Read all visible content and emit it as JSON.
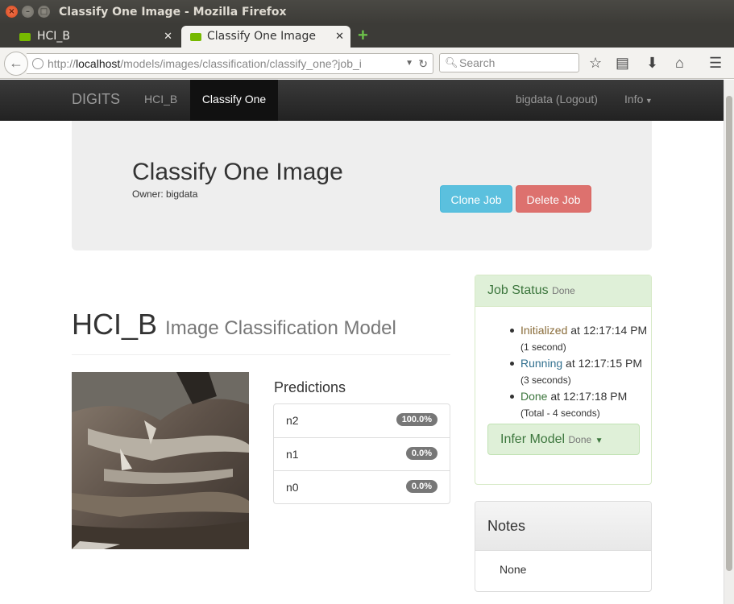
{
  "window": {
    "title": "Classify One Image - Mozilla Firefox"
  },
  "browser": {
    "tabs": [
      {
        "label": "HCI_B"
      },
      {
        "label": "Classify One Image"
      }
    ],
    "url_host": "localhost",
    "url_prefix": "http://",
    "url_path": "/models/images/classification/classify_one?job_i",
    "search_placeholder": "Search"
  },
  "app": {
    "brand": "DIGITS",
    "nav": {
      "model": "HCI_B",
      "active": "Classify One",
      "user": "bigdata (Logout)",
      "info": "Info"
    }
  },
  "page": {
    "title": "Classify One Image",
    "owner": "Owner: bigdata",
    "clone_label": "Clone Job",
    "delete_label": "Delete Job"
  },
  "model": {
    "name": "HCI_B",
    "subtitle": "Image Classification Model"
  },
  "predictions": {
    "heading": "Predictions",
    "items": [
      {
        "label": "n2",
        "value": "100.0%"
      },
      {
        "label": "n1",
        "value": "0.0%"
      },
      {
        "label": "n0",
        "value": "0.0%"
      }
    ]
  },
  "job_status": {
    "heading": "Job Status",
    "state": "Done",
    "steps": [
      {
        "name": "Initialized",
        "color": "#8a6d3b",
        "at": "at 12:17:14 PM",
        "note": "(1 second)"
      },
      {
        "name": "Running",
        "color": "#31708f",
        "at": "at 12:17:15 PM",
        "note": "(3 seconds)"
      },
      {
        "name": "Done",
        "color": "#3c763d",
        "at": "at 12:17:18 PM",
        "note": "(Total - 4 seconds)"
      }
    ],
    "infer_label": "Infer Model",
    "infer_state": "Done"
  },
  "notes": {
    "heading": "Notes",
    "body": "None"
  }
}
